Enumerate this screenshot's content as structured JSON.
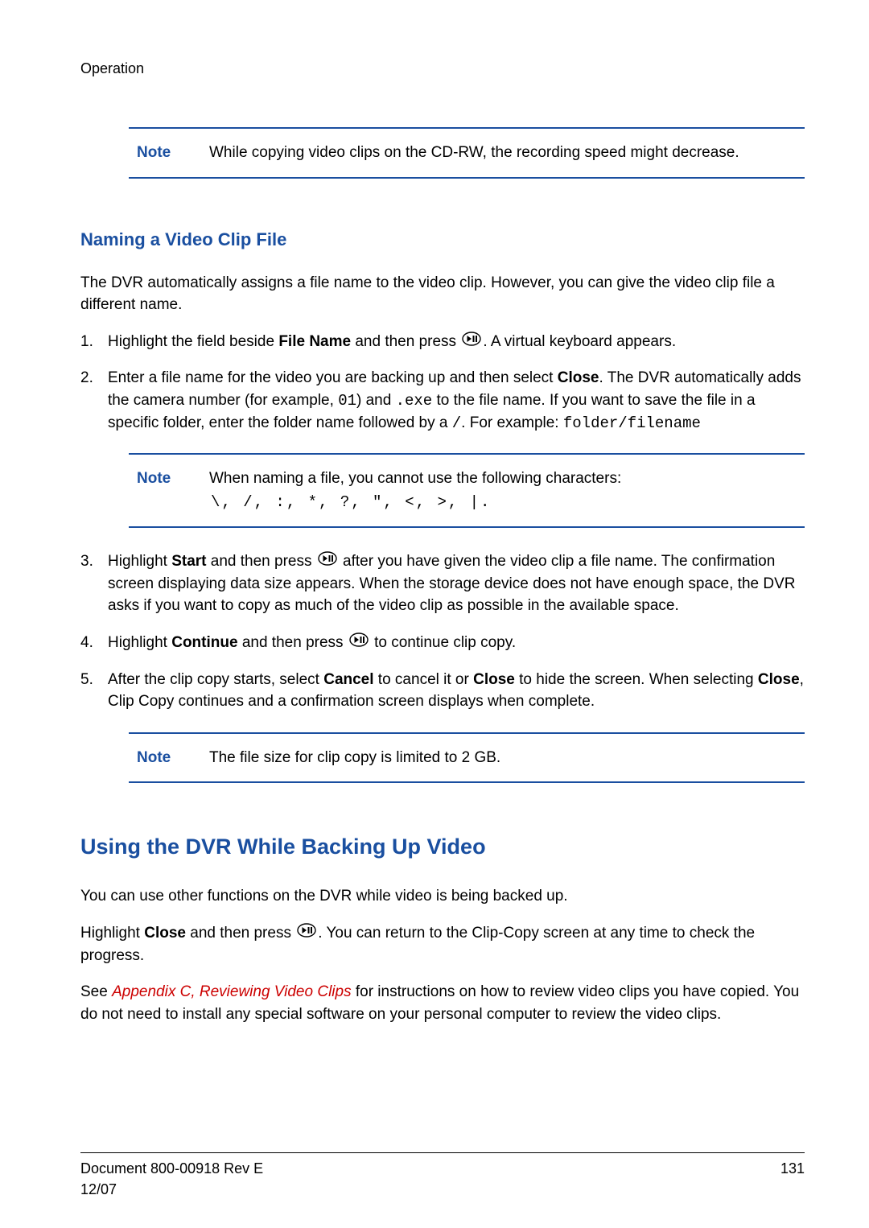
{
  "header": {
    "section": "Operation"
  },
  "note1": {
    "label": "Note",
    "text": "While copying video clips on the CD-RW, the recording speed might decrease."
  },
  "h3": "Naming a Video Clip File",
  "intro": "The DVR automatically assigns a file name to the video clip. However, you can give the video clip file a different name.",
  "steps": {
    "s1": {
      "num": "1.",
      "a": "Highlight the field beside ",
      "b_bold": "File Name",
      "c": " and then press ",
      "d": ". A virtual keyboard appears."
    },
    "s2": {
      "num": "2.",
      "a": "Enter a file name for the video you are backing up and then select ",
      "b_bold": "Close",
      "c": ". The DVR automatically adds the camera number (for example, ",
      "d_mono": "01",
      "e": ") and ",
      "f_mono": ".exe",
      "g": " to the file name. If you want to save the file in a specific folder, enter the folder name followed by a ",
      "h_mono": "/",
      "i": ". For example: ",
      "j_mono": "folder/filename"
    },
    "s3": {
      "num": "3.",
      "a": "Highlight ",
      "b_bold": "Start",
      "c": " and then press ",
      "d": " after you have given the video clip a file name. The confirmation screen displaying data size appears. When the storage device does not have enough space, the DVR asks if you want to copy as much of the video clip as possible in the available space."
    },
    "s4": {
      "num": "4.",
      "a": "Highlight ",
      "b_bold": "Continue",
      "c": " and then press ",
      "d": " to continue clip copy."
    },
    "s5": {
      "num": "5.",
      "a": "After the clip copy starts, select ",
      "b_bold": "Cancel",
      "c": " to cancel it or ",
      "d_bold": "Close",
      "e": " to hide the screen. When selecting ",
      "f_bold": "Close",
      "g": ", Clip Copy continues and a confirmation screen displays when complete."
    }
  },
  "note2": {
    "label": "Note",
    "line1": "When naming a file, you cannot use the following characters:",
    "chars": "\\, /, :, *, ?, \", <, >, |."
  },
  "note3": {
    "label": "Note",
    "text": "The file size for clip copy is limited to 2 GB."
  },
  "h2": "Using the DVR While Backing Up Video",
  "para1": "You can use other functions on the DVR while video is being backed up.",
  "para2": {
    "a": "Highlight ",
    "b_bold": "Close",
    "c": " and then press ",
    "d": ". You can return to the Clip-Copy screen at any time to check the progress."
  },
  "para3": {
    "a": "See ",
    "b_link": "Appendix C, Reviewing Video Clips",
    "c": " for instructions on how to review video clips you have copied. You do not need to install any special software on your personal computer to review the video clips."
  },
  "footer": {
    "doc": "Document 800-00918 Rev E",
    "date": "12/07",
    "page": "131"
  }
}
